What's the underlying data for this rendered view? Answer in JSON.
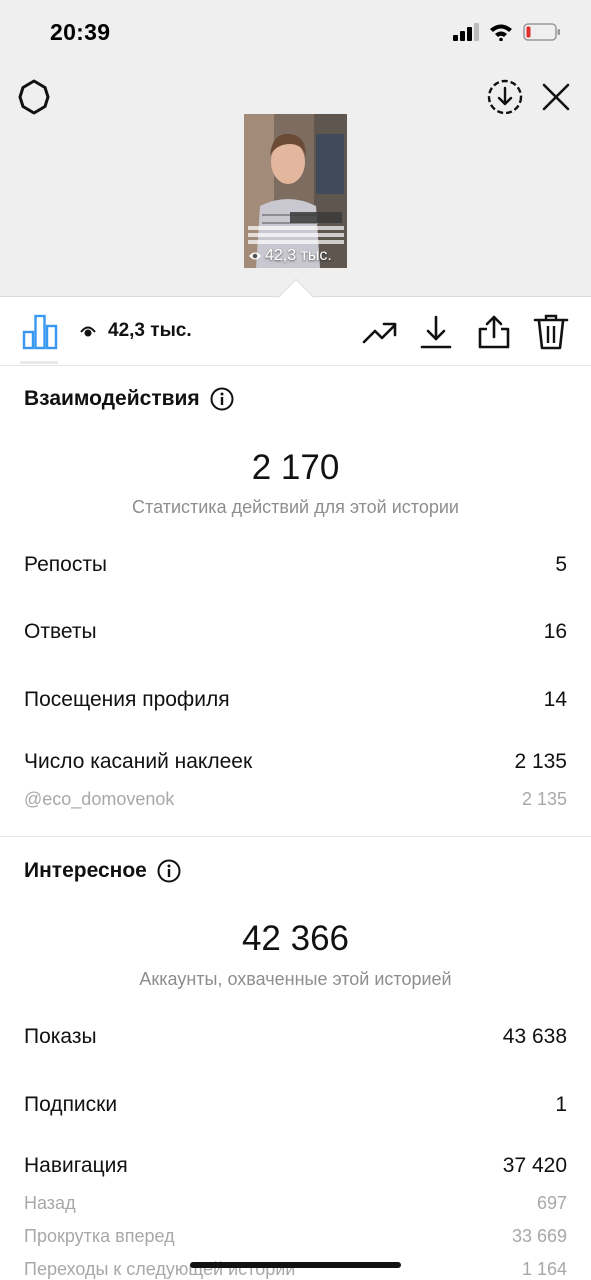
{
  "status_bar": {
    "time": "20:39"
  },
  "story": {
    "views_label": "42,3 тыс."
  },
  "toolbar": {
    "views": "42,3 тыс."
  },
  "interactions": {
    "title": "Взаимодействия",
    "total": "2 170",
    "caption": "Статистика действий для этой истории",
    "rows": [
      {
        "label": "Репосты",
        "value": "5"
      },
      {
        "label": "Ответы",
        "value": "16"
      },
      {
        "label": "Посещения профиля",
        "value": "14"
      },
      {
        "label": "Число касаний наклеек",
        "value": "2 135"
      }
    ],
    "sub_rows": [
      {
        "label": "@eco_domovenok",
        "value": "2 135"
      }
    ]
  },
  "discovery": {
    "title": "Интересное",
    "total": "42 366",
    "caption": "Аккаунты, охваченные этой историей",
    "rows": [
      {
        "label": "Показы",
        "value": "43 638"
      },
      {
        "label": "Подписки",
        "value": "1"
      },
      {
        "label": "Навигация",
        "value": "37 420"
      }
    ],
    "sub_rows": [
      {
        "label": "Назад",
        "value": "697"
      },
      {
        "label": "Прокрутка вперед",
        "value": "33 669"
      },
      {
        "label": "Переходы к следующей истории",
        "value": "1 164"
      }
    ]
  },
  "colors": {
    "accent": "#3897f0",
    "muted": "#8e8e8e",
    "divider": "#dbdbdb"
  }
}
